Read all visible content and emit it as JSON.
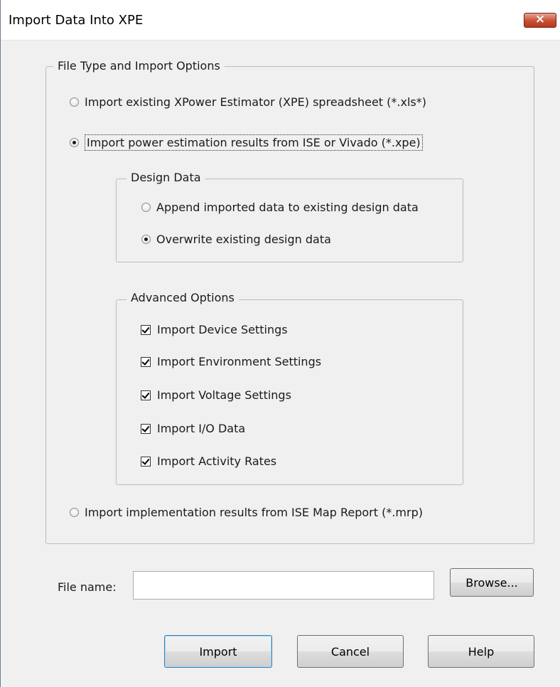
{
  "window": {
    "title": "Import Data Into XPE",
    "close_label": "×"
  },
  "file_type_group": {
    "legend": "File Type and Import Options",
    "options": [
      {
        "label": "Import existing XPower Estimator (XPE) spreadsheet (*.xls*)",
        "selected": false
      },
      {
        "label": "Import power estimation results from ISE or Vivado (*.xpe)",
        "selected": true
      },
      {
        "label": "Import implementation results from ISE Map Report (*.mrp)",
        "selected": false
      }
    ]
  },
  "design_data_group": {
    "legend": "Design Data",
    "options": [
      {
        "label": "Append imported data to existing design data",
        "selected": false
      },
      {
        "label": "Overwrite existing design data",
        "selected": true
      }
    ]
  },
  "advanced_group": {
    "legend": "Advanced Options",
    "checks": [
      {
        "label": "Import Device Settings",
        "checked": true
      },
      {
        "label": "Import Environment Settings",
        "checked": true
      },
      {
        "label": "Import Voltage Settings",
        "checked": true
      },
      {
        "label": "Import I/O Data",
        "checked": true
      },
      {
        "label": "Import Activity Rates",
        "checked": true
      }
    ]
  },
  "file": {
    "label": "File name:",
    "value": "",
    "browse_label": "Browse..."
  },
  "buttons": {
    "import": "Import",
    "cancel": "Cancel",
    "help": "Help"
  }
}
